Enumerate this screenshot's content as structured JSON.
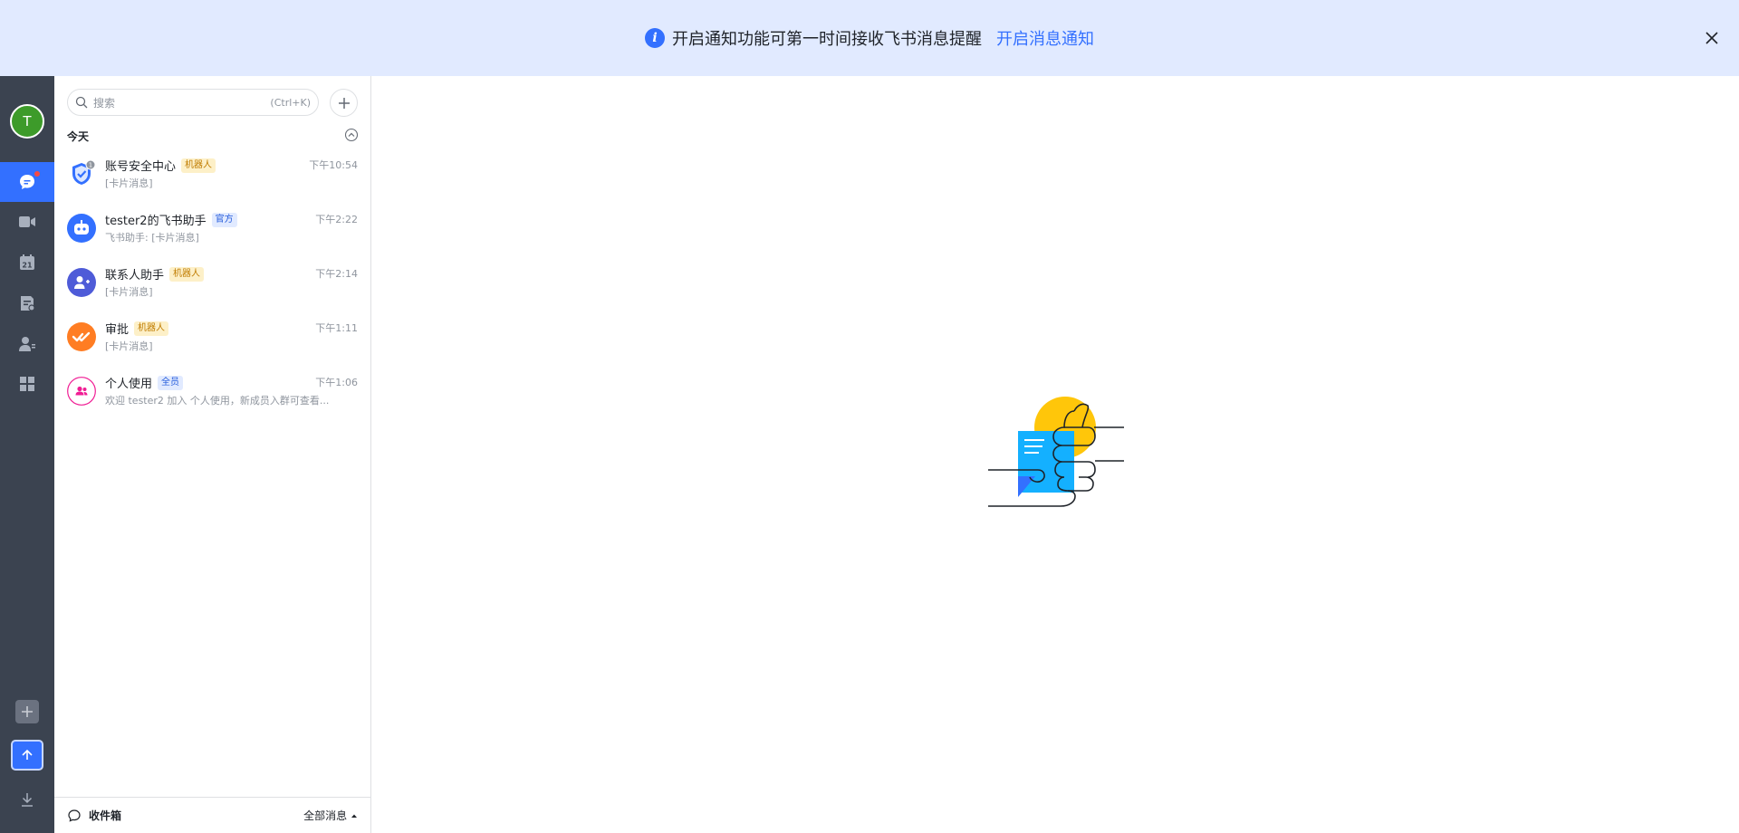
{
  "banner": {
    "message": "开启通知功能可第一时间接收飞书消息提醒",
    "link": "开启消息通知"
  },
  "user": {
    "avatar_letter": "T",
    "avatar_color": "#3d9b2a"
  },
  "colors": {
    "accent": "#3370ff",
    "rail_bg": "#3b4350",
    "unread": "#f54a45"
  },
  "search": {
    "placeholder": "搜索",
    "shortcut": "(Ctrl+K)"
  },
  "list": {
    "section_title": "今天",
    "items": [
      {
        "name": "账号安全中心",
        "tag": "机器人",
        "time": "下午10:54",
        "preview": "[卡片消息]",
        "icon": "shield-icon"
      },
      {
        "name": "tester2的飞书助手",
        "tag": "官方",
        "time": "下午2:22",
        "preview": "飞书助手: [卡片消息]",
        "icon": "bot-icon"
      },
      {
        "name": "联系人助手",
        "tag": "机器人",
        "time": "下午2:14",
        "preview": "[卡片消息]",
        "icon": "contact-icon"
      },
      {
        "name": "审批",
        "tag": "机器人",
        "time": "下午1:11",
        "preview": "[卡片消息]",
        "icon": "approval-icon"
      },
      {
        "name": "个人使用",
        "tag": "全员",
        "time": "下午1:06",
        "preview": "欢迎 tester2 加入 个人使用，新成员入群可查看...",
        "icon": "group-icon"
      }
    ]
  },
  "footer": {
    "inbox": "收件箱",
    "filter": "全部消息"
  }
}
